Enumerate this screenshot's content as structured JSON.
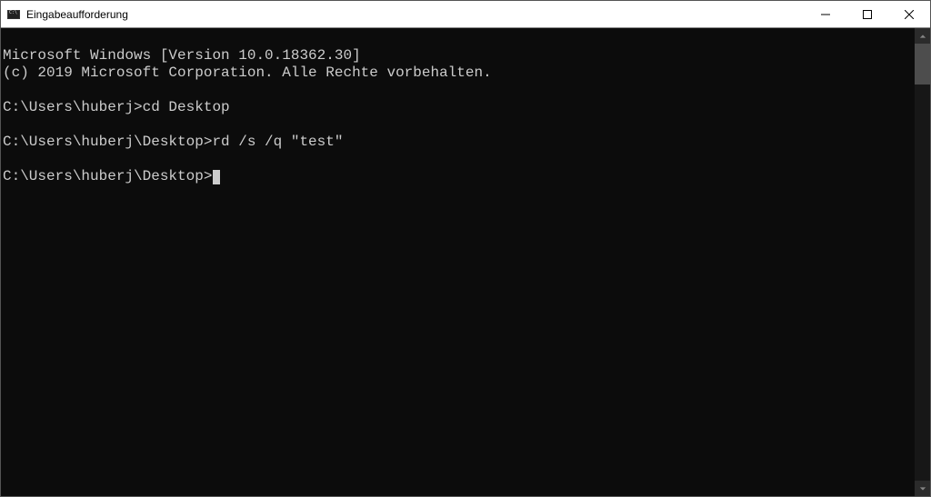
{
  "window": {
    "title": "Eingabeaufforderung"
  },
  "terminal": {
    "lines": [
      "Microsoft Windows [Version 10.0.18362.30]",
      "(c) 2019 Microsoft Corporation. Alle Rechte vorbehalten.",
      "",
      "C:\\Users\\huberj>cd Desktop",
      "",
      "C:\\Users\\huberj\\Desktop>rd /s /q \"test\"",
      "",
      "C:\\Users\\huberj\\Desktop>"
    ]
  }
}
